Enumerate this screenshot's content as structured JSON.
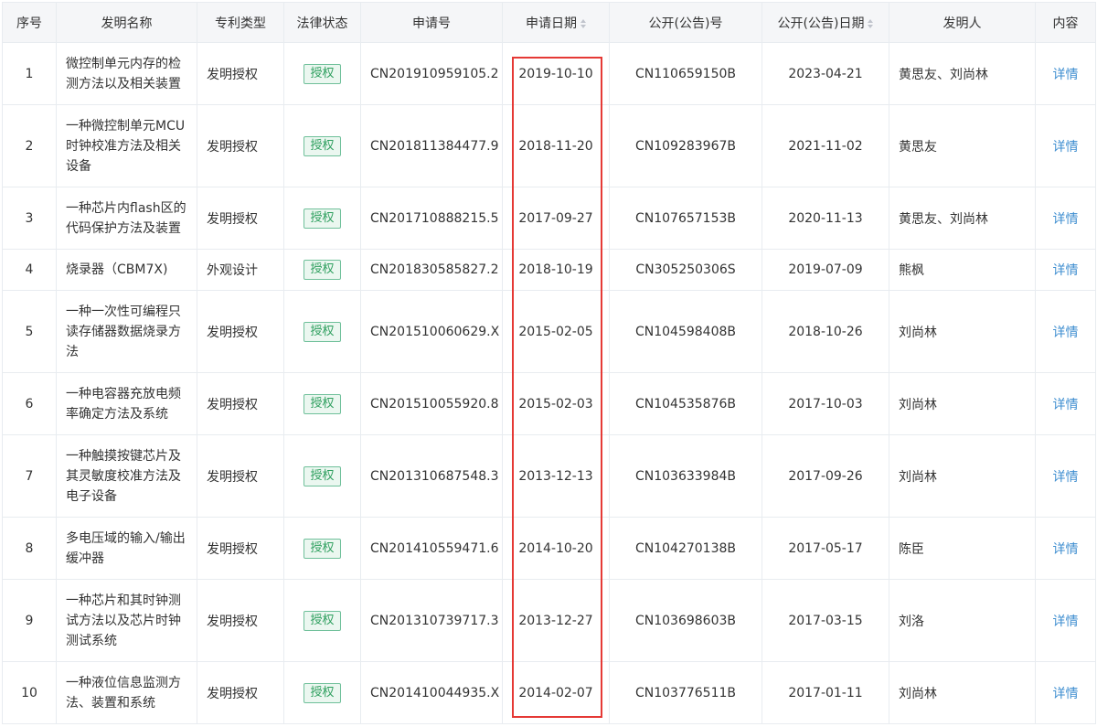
{
  "columns": [
    "序号",
    "发明名称",
    "专利类型",
    "法律状态",
    "申请号",
    "申请日期",
    "公开(公告)号",
    "公开(公告)日期",
    "发明人",
    "内容"
  ],
  "rows": [
    {
      "no": "1",
      "title": "微控制单元内存的检测方法以及相关装置",
      "type": "发明授权",
      "status": "授权",
      "app_no": "CN201910959105.2",
      "app_date": "2019-10-10",
      "pub_no": "CN110659150B",
      "pub_date": "2023-04-21",
      "inventors": "黄思友、刘尚林",
      "link": "详情"
    },
    {
      "no": "2",
      "title": "一种微控制单元MCU时钟校准方法及相关设备",
      "type": "发明授权",
      "status": "授权",
      "app_no": "CN201811384477.9",
      "app_date": "2018-11-20",
      "pub_no": "CN109283967B",
      "pub_date": "2021-11-02",
      "inventors": "黄思友",
      "link": "详情"
    },
    {
      "no": "3",
      "title": "一种芯片内flash区的代码保护方法及装置",
      "type": "发明授权",
      "status": "授权",
      "app_no": "CN201710888215.5",
      "app_date": "2017-09-27",
      "pub_no": "CN107657153B",
      "pub_date": "2020-11-13",
      "inventors": "黄思友、刘尚林",
      "link": "详情"
    },
    {
      "no": "4",
      "title": "烧录器（CBM7X)",
      "type": "外观设计",
      "status": "授权",
      "app_no": "CN201830585827.2",
      "app_date": "2018-10-19",
      "pub_no": "CN305250306S",
      "pub_date": "2019-07-09",
      "inventors": "熊枫",
      "link": "详情"
    },
    {
      "no": "5",
      "title": "一种一次性可编程只读存储器数据烧录方法",
      "type": "发明授权",
      "status": "授权",
      "app_no": "CN201510060629.X",
      "app_date": "2015-02-05",
      "pub_no": "CN104598408B",
      "pub_date": "2018-10-26",
      "inventors": "刘尚林",
      "link": "详情"
    },
    {
      "no": "6",
      "title": "一种电容器充放电频率确定方法及系统",
      "type": "发明授权",
      "status": "授权",
      "app_no": "CN201510055920.8",
      "app_date": "2015-02-03",
      "pub_no": "CN104535876B",
      "pub_date": "2017-10-03",
      "inventors": "刘尚林",
      "link": "详情"
    },
    {
      "no": "7",
      "title": "一种触摸按键芯片及其灵敏度校准方法及电子设备",
      "type": "发明授权",
      "status": "授权",
      "app_no": "CN201310687548.3",
      "app_date": "2013-12-13",
      "pub_no": "CN103633984B",
      "pub_date": "2017-09-26",
      "inventors": "刘尚林",
      "link": "详情"
    },
    {
      "no": "8",
      "title": "多电压域的输入/输出缓冲器",
      "type": "发明授权",
      "status": "授权",
      "app_no": "CN201410559471.6",
      "app_date": "2014-10-20",
      "pub_no": "CN104270138B",
      "pub_date": "2017-05-17",
      "inventors": "陈臣",
      "link": "详情"
    },
    {
      "no": "9",
      "title": "一种芯片和其时钟测试方法以及芯片时钟测试系统",
      "type": "发明授权",
      "status": "授权",
      "app_no": "CN201310739717.3",
      "app_date": "2013-12-27",
      "pub_no": "CN103698603B",
      "pub_date": "2017-03-15",
      "inventors": "刘洛",
      "link": "详情"
    },
    {
      "no": "10",
      "title": "一种液位信息监测方法、装置和系统",
      "type": "发明授权",
      "status": "授权",
      "app_no": "CN201410044935.X",
      "app_date": "2014-02-07",
      "pub_no": "CN103776511B",
      "pub_date": "2017-01-11",
      "inventors": "刘尚林",
      "link": "详情"
    }
  ],
  "colors": {
    "highlight_border": "#e53935",
    "status_badge": "#2e9f5e",
    "link": "#3e8ed0",
    "header_bg": "#f5f6f8"
  }
}
